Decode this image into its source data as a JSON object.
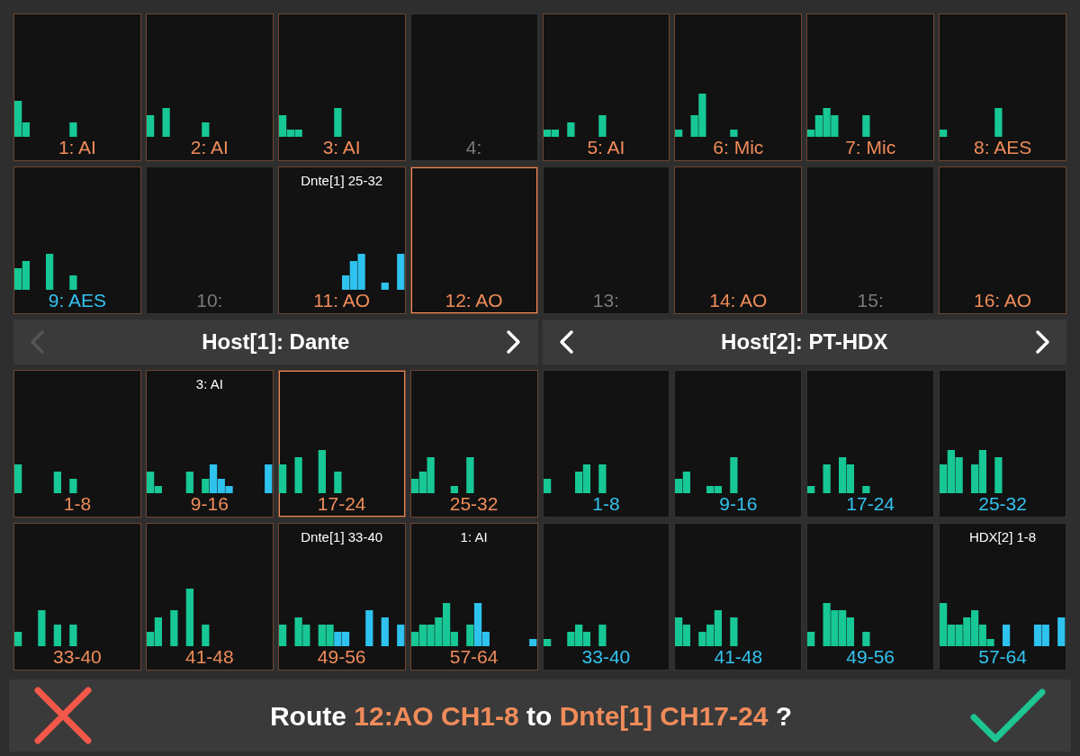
{
  "source_tiles": [
    {
      "label": "1: AI",
      "color": "#f08c5a",
      "outlined": true,
      "selected": false
    },
    {
      "label": "2: AI",
      "color": "#f08c5a",
      "outlined": true,
      "selected": false
    },
    {
      "label": "3: AI",
      "color": "#f08c5a",
      "outlined": true,
      "selected": false
    },
    {
      "label": "4:",
      "color": "#7a7a7a",
      "outlined": false,
      "selected": false
    },
    {
      "label": "5: AI",
      "color": "#f08c5a",
      "outlined": true,
      "selected": false
    },
    {
      "label": "6: Mic",
      "color": "#f08c5a",
      "outlined": true,
      "selected": false
    },
    {
      "label": "7: Mic",
      "color": "#f08c5a",
      "outlined": true,
      "selected": false
    },
    {
      "label": "8: AES",
      "color": "#f08c5a",
      "outlined": true,
      "selected": false
    },
    {
      "label": "9: AES",
      "color": "#33c3f0",
      "outlined": true,
      "selected": false
    },
    {
      "label": "10:",
      "color": "#7a7a7a",
      "outlined": false,
      "selected": false
    },
    {
      "header": "Dnte[1] 25-32",
      "label": "11: AO",
      "color": "#f08c5a",
      "outlined": true,
      "selected": false
    },
    {
      "label": "12: AO",
      "color": "#f08c5a",
      "outlined": true,
      "selected": true
    },
    {
      "label": "13:",
      "color": "#7a7a7a",
      "outlined": false,
      "selected": false
    },
    {
      "label": "14: AO",
      "color": "#f08c5a",
      "outlined": true,
      "selected": false
    },
    {
      "label": "15:",
      "color": "#7a7a7a",
      "outlined": false,
      "selected": false
    },
    {
      "label": "16: AO",
      "color": "#f08c5a",
      "outlined": true,
      "selected": false
    }
  ],
  "hosts": [
    {
      "title": "Host[1]: Dante",
      "prev_disabled": true,
      "next_disabled": false,
      "tiles": [
        {
          "label": "1-8",
          "color": "#f08c5a",
          "outlined": true,
          "selected": false
        },
        {
          "header": "3: AI",
          "label": "9-16",
          "color": "#f08c5a",
          "outlined": true,
          "selected": false
        },
        {
          "label": "17-24",
          "color": "#f08c5a",
          "outlined": true,
          "selected": true
        },
        {
          "label": "25-32",
          "color": "#f08c5a",
          "outlined": true,
          "selected": false
        },
        {
          "label": "33-40",
          "color": "#f08c5a",
          "outlined": true,
          "selected": false
        },
        {
          "label": "41-48",
          "color": "#f08c5a",
          "outlined": true,
          "selected": false
        },
        {
          "header": "Dnte[1] 33-40",
          "label": "49-56",
          "color": "#f08c5a",
          "outlined": true,
          "selected": false
        },
        {
          "header": "1: AI",
          "label": "57-64",
          "color": "#f08c5a",
          "outlined": true,
          "selected": false
        }
      ]
    },
    {
      "title": "Host[2]: PT-HDX",
      "prev_disabled": false,
      "next_disabled": false,
      "tiles": [
        {
          "label": "1-8",
          "color": "#33c3f0",
          "outlined": false,
          "selected": false
        },
        {
          "label": "9-16",
          "color": "#33c3f0",
          "outlined": false,
          "selected": false
        },
        {
          "label": "17-24",
          "color": "#33c3f0",
          "outlined": false,
          "selected": false
        },
        {
          "label": "25-32",
          "color": "#33c3f0",
          "outlined": false,
          "selected": false
        },
        {
          "label": "33-40",
          "color": "#33c3f0",
          "outlined": false,
          "selected": false
        },
        {
          "label": "41-48",
          "color": "#33c3f0",
          "outlined": false,
          "selected": false
        },
        {
          "label": "49-56",
          "color": "#33c3f0",
          "outlined": false,
          "selected": false
        },
        {
          "header": "HDX[2] 1-8",
          "label": "57-64",
          "color": "#33c3f0",
          "outlined": false,
          "selected": false
        }
      ]
    }
  ],
  "prompt": [
    {
      "text": "Route ",
      "highlight": false
    },
    {
      "text": "12:AO CH1-8",
      "highlight": true
    },
    {
      "text": " to ",
      "highlight": false
    },
    {
      "text": "Dnte[1] CH17-24",
      "highlight": true
    },
    {
      "text": " ?",
      "highlight": false
    }
  ]
}
